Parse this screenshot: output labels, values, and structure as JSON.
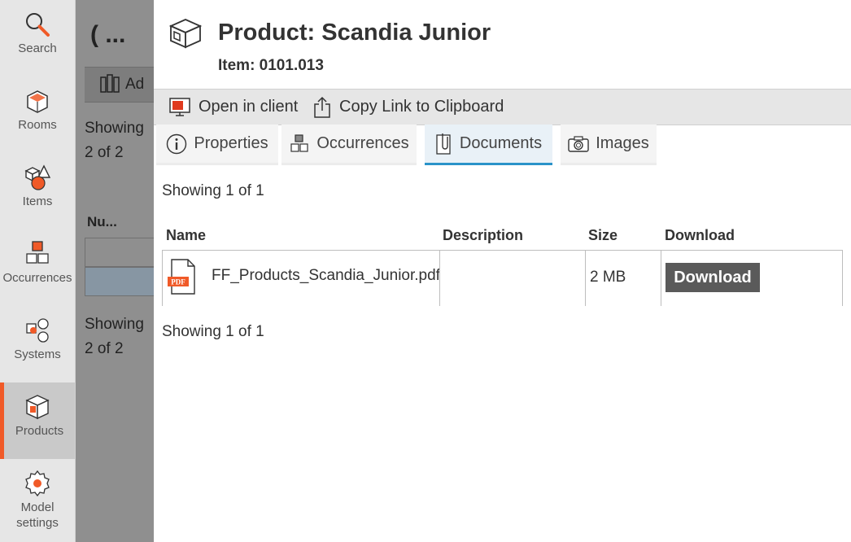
{
  "nav": {
    "items": [
      {
        "label": "Search",
        "icon": "search-icon"
      },
      {
        "label": "Rooms",
        "icon": "rooms-icon"
      },
      {
        "label": "Items",
        "icon": "items-icon"
      },
      {
        "label": "Occurrences",
        "icon": "occurrences-icon"
      },
      {
        "label": "Systems",
        "icon": "systems-icon"
      },
      {
        "label": "Products",
        "icon": "products-icon",
        "active": true
      },
      {
        "label": "Model settings",
        "icon": "gear-icon"
      }
    ],
    "accent": "#f05a28"
  },
  "background_page": {
    "title": "( ...",
    "add_label": "Ad",
    "showing_top": "Showing",
    "count_top": "2 of 2",
    "col_header": "Nu...",
    "showing_bottom": "Showing",
    "count_bottom": "2 of 2"
  },
  "panel": {
    "title": "Product: Scandia Junior",
    "subtitle": "Item: 0101.013",
    "toolbar": {
      "open_client": "Open in client",
      "copy_link": "Copy Link to Clipboard"
    },
    "tabs": [
      {
        "label": "Properties",
        "icon": "info-icon"
      },
      {
        "label": "Occurrences",
        "icon": "occurrences-icon"
      },
      {
        "label": "Documents",
        "icon": "paperclip-icon",
        "active": true
      },
      {
        "label": "Images",
        "icon": "camera-icon"
      }
    ],
    "showing_top": "Showing 1 of 1",
    "showing_bottom": "Showing 1 of 1",
    "table": {
      "headers": {
        "name": "Name",
        "description": "Description",
        "size": "Size",
        "download": "Download"
      },
      "rows": [
        {
          "name": "FF_Products_Scandia_Junior.pdf",
          "description": "",
          "size": "2 MB",
          "download_label": "Download",
          "file_icon": "pdf-file-icon",
          "badge": "PDF"
        }
      ]
    },
    "tab_accent": "#2a93c9"
  }
}
